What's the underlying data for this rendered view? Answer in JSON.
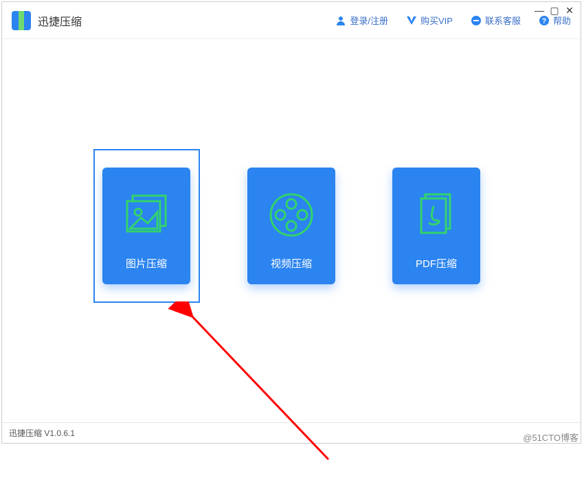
{
  "app": {
    "title": "迅捷压缩"
  },
  "header": {
    "login": "登录/注册",
    "vip": "购买VIP",
    "support": "联系客服",
    "help": "帮助"
  },
  "tiles": {
    "image": "图片压缩",
    "video": "视频压缩",
    "pdf": "PDF压缩"
  },
  "footer": {
    "status": "迅捷压缩 V1.0.6.1"
  },
  "watermark": "@51CTO博客",
  "colors": {
    "primary": "#2b84f0",
    "accent": "#33d36b"
  }
}
